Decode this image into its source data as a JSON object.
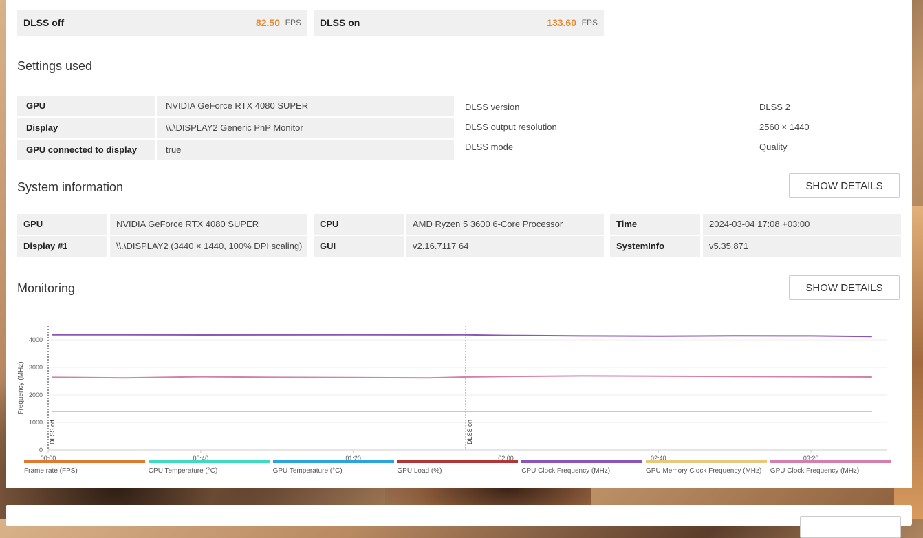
{
  "fps": [
    {
      "label": "DLSS off",
      "value": "82.50",
      "unit": "FPS"
    },
    {
      "label": "DLSS on",
      "value": "133.60",
      "unit": "FPS"
    }
  ],
  "settings": {
    "title": "Settings used",
    "table": [
      {
        "label": "GPU",
        "value": "NVIDIA GeForce RTX 4080 SUPER"
      },
      {
        "label": "Display",
        "value": "\\\\.\\DISPLAY2 Generic PnP Monitor"
      },
      {
        "label": "GPU connected to display",
        "value": "true"
      }
    ],
    "dlss": [
      {
        "label": "DLSS version",
        "value": "DLSS 2"
      },
      {
        "label": "DLSS output resolution",
        "value": "2560 × 1440"
      },
      {
        "label": "DLSS mode",
        "value": "Quality"
      }
    ]
  },
  "system": {
    "title": "System information",
    "button": "SHOW DETAILS",
    "cells": [
      {
        "label": "GPU",
        "value": "NVIDIA GeForce RTX 4080 SUPER"
      },
      {
        "label": "CPU",
        "value": "AMD Ryzen 5 3600 6-Core Processor"
      },
      {
        "label": "Time",
        "value": "2024-03-04 17:08 +03:00"
      },
      {
        "label": "Display #1",
        "value": "\\\\.\\DISPLAY2 (3440 × 1440, 100% DPI scaling)"
      },
      {
        "label": "GUI",
        "value": "v2.16.7117 64"
      },
      {
        "label": "SystemInfo",
        "value": "v5.35.871"
      }
    ]
  },
  "monitoring": {
    "title": "Monitoring",
    "button": "SHOW DETAILS"
  },
  "chart_data": {
    "type": "line",
    "ylabel": "Frequency (MHz)",
    "xlabel": "",
    "ylim": [
      0,
      4500
    ],
    "yticks": [
      0,
      1000,
      2000,
      3000,
      4000
    ],
    "xticks": [
      "00:00",
      "00:40",
      "01:20",
      "02:00",
      "02:40",
      "03:20"
    ],
    "xlim_seconds": [
      0,
      220
    ],
    "markers": [
      {
        "label": "DLSS off",
        "x": 0
      },
      {
        "label": "DLSS on",
        "x": 109.5
      }
    ],
    "x_seconds": [
      1,
      20,
      40,
      60,
      80,
      100,
      109,
      120,
      140,
      160,
      180,
      200,
      216
    ],
    "series": [
      {
        "name": "CPU Clock Frequency (MHz)",
        "color": "#8e55b8",
        "values": [
          4180,
          4180,
          4175,
          4178,
          4180,
          4178,
          4180,
          4160,
          4140,
          4130,
          4145,
          4140,
          4120
        ]
      },
      {
        "name": "GPU Memory Clock Frequency (MHz)",
        "color": "#e6c97a",
        "values": [
          1400,
          1400,
          1400,
          1400,
          1400,
          1400,
          1400,
          1400,
          1400,
          1400,
          1400,
          1400,
          1400
        ]
      },
      {
        "name": "GPU Clock Frequency (MHz)",
        "color": "#d47fae",
        "values": [
          2640,
          2620,
          2660,
          2640,
          2630,
          2620,
          2650,
          2670,
          2690,
          2680,
          2670,
          2660,
          2650
        ]
      }
    ],
    "legend": [
      {
        "name": "Frame rate (FPS)",
        "color": "#e07a2e"
      },
      {
        "name": "CPU Temperature (°C)",
        "color": "#3ddbc2"
      },
      {
        "name": "GPU Temperature (°C)",
        "color": "#2aa4de"
      },
      {
        "name": "GPU Load (%)",
        "color": "#b33538"
      },
      {
        "name": "CPU Clock Frequency (MHz)",
        "color": "#8e55b8"
      },
      {
        "name": "GPU Memory Clock Frequency (MHz)",
        "color": "#e6c97a"
      },
      {
        "name": "GPU Clock Frequency (MHz)",
        "color": "#d47fae"
      }
    ]
  }
}
